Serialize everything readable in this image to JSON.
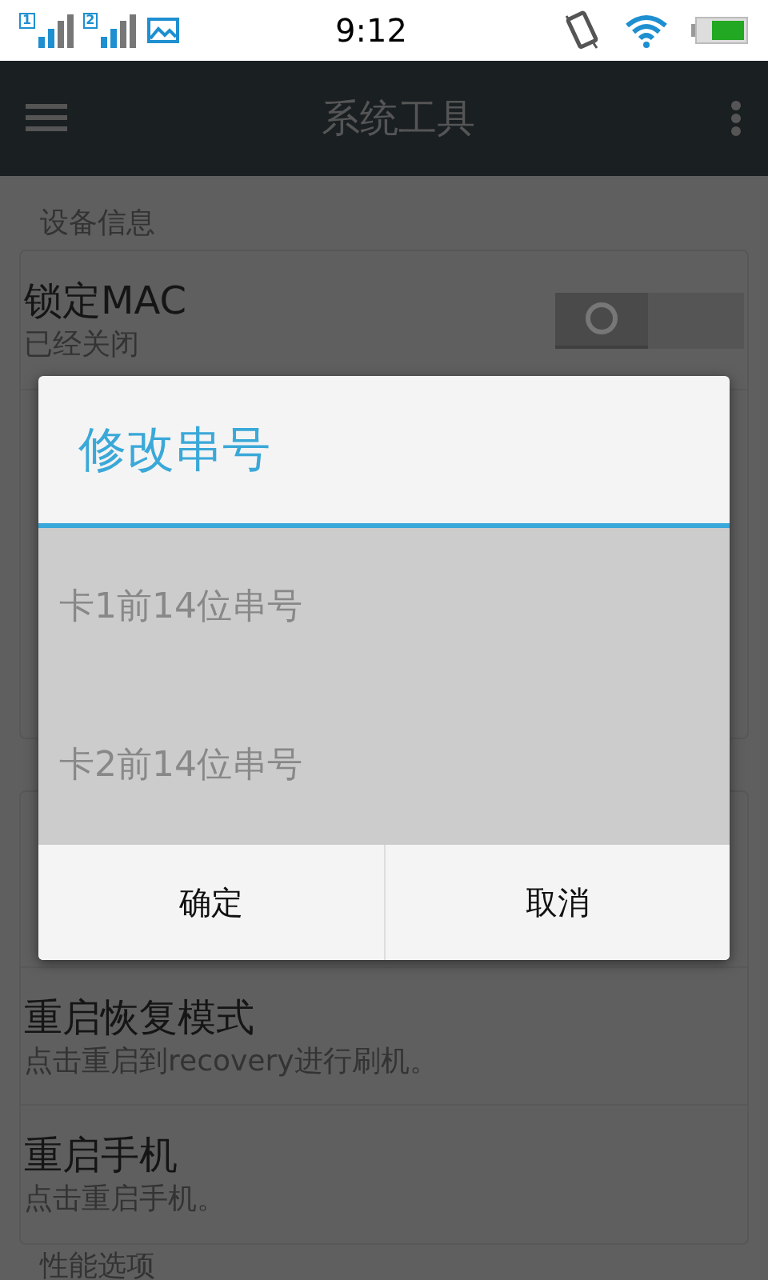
{
  "status_bar": {
    "sims": [
      "1",
      "2"
    ],
    "time": "9:12"
  },
  "app_bar": {
    "title": "系统工具"
  },
  "sections": [
    {
      "header": "设备信息",
      "items": [
        {
          "kind": "toggle",
          "title": "锁定MAC",
          "subtitle_lines": [
            "已经关闭"
          ],
          "on": false
        }
      ]
    },
    {
      "items": [
        {
          "kind": "plain",
          "title": "重启恢复模式",
          "subtitle_lines": [
            "点击重启到recovery进行刷机。"
          ]
        },
        {
          "kind": "plain",
          "title": "重启手机",
          "subtitle_lines": [
            "点击重启手机。"
          ]
        }
      ]
    },
    {
      "header": "性能选项"
    }
  ],
  "dialog": {
    "title": "修改串号",
    "fields": [
      {
        "placeholder": "卡1前14位串号"
      },
      {
        "placeholder": "卡2前14位串号"
      }
    ],
    "buttons": [
      "确定",
      "取消"
    ]
  }
}
